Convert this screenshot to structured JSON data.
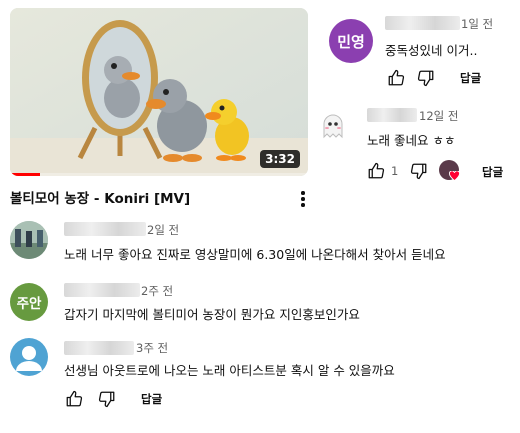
{
  "video": {
    "title": "볼티모어 농장 - Koniri [MV]",
    "duration": "3:32",
    "progress_fraction": 0.1,
    "accent_color": "#ff0000"
  },
  "right_comments": [
    {
      "avatar_text": "민영",
      "avatar_color": "#8b3fb0",
      "time": "1일 전",
      "text": "중독성있네 이거..",
      "reply_label": "답글"
    },
    {
      "avatar_icon": "ghost-icon",
      "time": "12일 전",
      "text": "노래 좋네요 ㅎㅎ",
      "like_count": "1",
      "reply_label": "답글"
    }
  ],
  "left_comments": [
    {
      "avatar_icon": "photo-avatar",
      "time": "2일 전",
      "text": "노래 너무 좋아요 진짜로 영상말미에 6.30일에 나온다해서 찾아서 듣네요"
    },
    {
      "avatar_text": "주안",
      "avatar_color": "#679a3f",
      "time": "2주 전",
      "text": "갑자기 마지막에 볼티미어 농장이 뭔가요 지인홍보인가요"
    },
    {
      "avatar_icon": "default-person-icon",
      "avatar_color": "#4fa3d3",
      "time": "3주 전",
      "text": "선생님 아웃트로에 나오는 노래 아티스트분 혹시 알 수 있을까요",
      "reply_label": "답글"
    }
  ]
}
